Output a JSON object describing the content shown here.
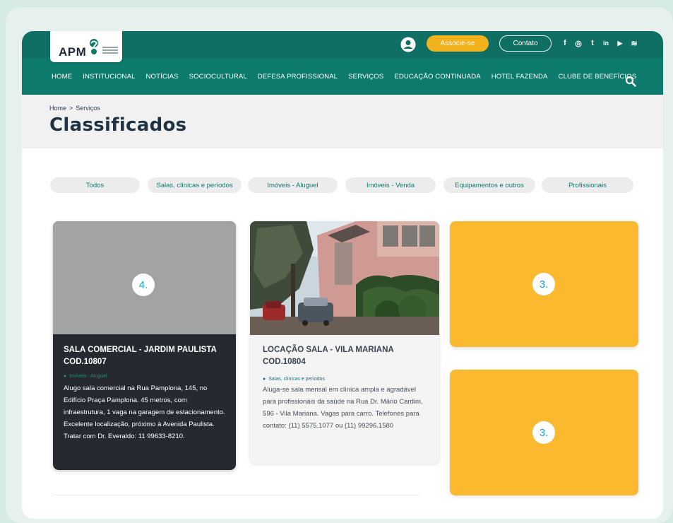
{
  "header": {
    "logo_text": "APM",
    "associe_label": "Associe-se",
    "contato_label": "Contato",
    "social_icons": [
      "facebook-icon",
      "instagram-icon",
      "twitter-icon",
      "linkedin-icon",
      "youtube-icon",
      "spotify-icon"
    ],
    "social_glyphs": [
      "f",
      "◎",
      "t",
      "in",
      "▶",
      "≋"
    ],
    "colors": {
      "topbar": "#0f6f62",
      "navbar": "#0d7b6b",
      "accent": "#f2b21c"
    }
  },
  "nav": {
    "items": [
      "HOME",
      "INSTITUCIONAL",
      "NOTÍCIAS",
      "SOCIOCULTURAL",
      "DEFESA PROFISSIONAL",
      "SERVIÇOS",
      "EDUCAÇÃO CONTINUADA",
      "HOTEL FAZENDA",
      "CLUBE DE BENEFÍCIOS"
    ]
  },
  "breadcrumb": {
    "home": "Home",
    "separator": ">",
    "current": "Serviços"
  },
  "page_title": "Classificados",
  "filters": [
    "Todos",
    "Salas, clínicas e períodos",
    "Imóveis - Aluguel",
    "Imóveis - Venda",
    "Equipamentos e outros",
    "Profissionais"
  ],
  "cards": {
    "dark": {
      "badge": "4.",
      "title_line1": "SALA COMERCIAL - JARDIM PAULISTA",
      "title_line2": "COD.10807",
      "category": "Imóveis - Aluguel",
      "description": "Alugo sala comercial na Rua Pamplona, 145, no Edifício Praça Pamplona. 45 metros, com infraestrutura, 1 vaga na garagem de estacionamento. Excelente localização, próximo à Avenida Paulista. Tratar com Dr. Everaldo: 11 99633-8210."
    },
    "light": {
      "title_line1": "LOCAÇÃO SALA - VILA MARIANA",
      "title_line2": "COD.10804",
      "category": "Salas, clínicas e períodos",
      "description": "Aluga-se sala mensal em clínica ampla e agradável para profissionais da saúde na Rua Dr. Mário Cardim, 596 - Vila Mariana. Vagas para carro. Telefones para contato: (11) 5575.1077 ou (11) 99296.1580"
    },
    "yellow1": {
      "badge": "3."
    },
    "yellow2": {
      "badge": "3."
    }
  }
}
